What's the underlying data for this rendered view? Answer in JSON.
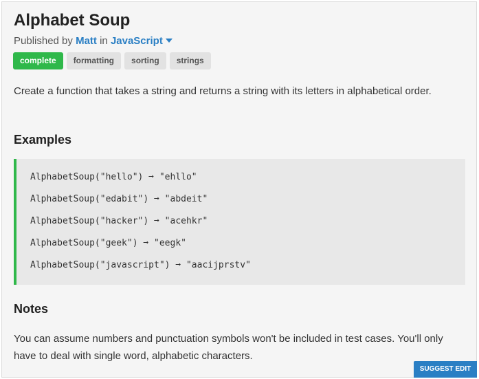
{
  "challenge": {
    "title": "Alphabet Soup",
    "byline_prefix": "Published by",
    "author": "Matt",
    "byline_in": "in",
    "language": "JavaScript"
  },
  "tags": [
    {
      "label": "complete",
      "status": "complete",
      "color": "#2fb84a"
    },
    {
      "label": "formatting"
    },
    {
      "label": "sorting"
    },
    {
      "label": "strings"
    }
  ],
  "description": "Create a function that takes a string and returns a string with its letters in alphabetical order.",
  "examples": {
    "heading": "Examples",
    "accent_color": "#2fb84a",
    "lines": [
      "AlphabetSoup(\"hello\") ➞ \"ehllo\"",
      "AlphabetSoup(\"edabit\") ➞ \"abdeit\"",
      "AlphabetSoup(\"hacker\") ➞ \"acehkr\"",
      "AlphabetSoup(\"geek\") ➞ \"eegk\"",
      "AlphabetSoup(\"javascript\") ➞ \"aacijprstv\""
    ]
  },
  "notes": {
    "heading": "Notes",
    "text": "You can assume numbers and punctuation symbols won't be included in test cases. You'll only have to deal with single word, alphabetic characters."
  },
  "actions": {
    "suggest_edit": "SUGGEST EDIT",
    "accent_color": "#2a7fc4"
  }
}
